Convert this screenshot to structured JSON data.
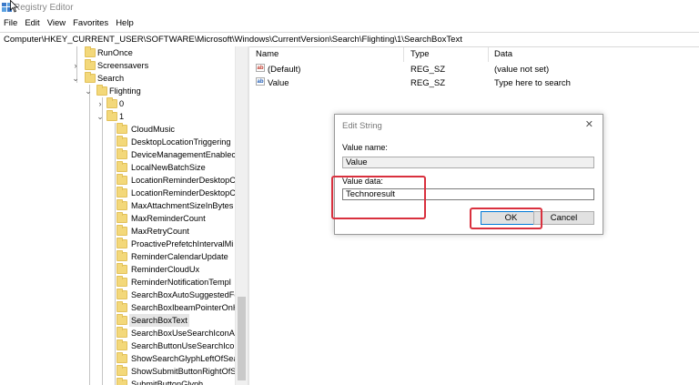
{
  "window": {
    "title": "Registry Editor"
  },
  "menu": [
    "File",
    "Edit",
    "View",
    "Favorites",
    "Help"
  ],
  "address": "Computer\\HKEY_CURRENT_USER\\SOFTWARE\\Microsoft\\Windows\\CurrentVersion\\Search\\Flighting\\1\\SearchBoxText",
  "tree": {
    "items": [
      {
        "label": "RunOnce"
      },
      {
        "label": "Screensavers"
      },
      {
        "label": "Search"
      },
      {
        "label": "Flighting"
      },
      {
        "label": "0"
      },
      {
        "label": "1"
      },
      {
        "label": "CloudMusic"
      },
      {
        "label": "DesktopLocationTriggering"
      },
      {
        "label": "DeviceManagementEnablec"
      },
      {
        "label": "LocalNewBatchSize"
      },
      {
        "label": "LocationReminderDesktopC"
      },
      {
        "label": "LocationReminderDesktopC"
      },
      {
        "label": "MaxAttachmentSizeInBytes"
      },
      {
        "label": "MaxReminderCount"
      },
      {
        "label": "MaxRetryCount"
      },
      {
        "label": "ProactivePrefetchIntervalMi"
      },
      {
        "label": "ReminderCalendarUpdate"
      },
      {
        "label": "ReminderCloudUx"
      },
      {
        "label": "ReminderNotificationTempl"
      },
      {
        "label": "SearchBoxAutoSuggestedFc"
      },
      {
        "label": "SearchBoxIbeamPointerOnH"
      },
      {
        "label": "SearchBoxText"
      },
      {
        "label": "SearchBoxUseSearchIconAtl"
      },
      {
        "label": "SearchButtonUseSearchIcor"
      },
      {
        "label": "ShowSearchGlyphLeftOfSea"
      },
      {
        "label": "ShowSubmitButtonRightOfS"
      },
      {
        "label": "SubmitButtonGlyph"
      }
    ]
  },
  "list": {
    "columns": [
      "Name",
      "Type",
      "Data"
    ],
    "rows": [
      {
        "icon": "string-value-icon",
        "name": "(Default)",
        "type": "REG_SZ",
        "data": "(value not set)"
      },
      {
        "icon": "string-value-icon",
        "name": "Value",
        "type": "REG_SZ",
        "data": "Type here to search"
      }
    ]
  },
  "dialog": {
    "title": "Edit String",
    "value_name_label": "Value name:",
    "value_name": "Value",
    "value_data_label": "Value data:",
    "value_data": "Technoresult",
    "ok_label": "OK",
    "cancel_label": "Cancel"
  },
  "colors": {
    "highlight": "#d9303e",
    "folder": "#f3d87a",
    "selection": "#e5e5e5"
  }
}
